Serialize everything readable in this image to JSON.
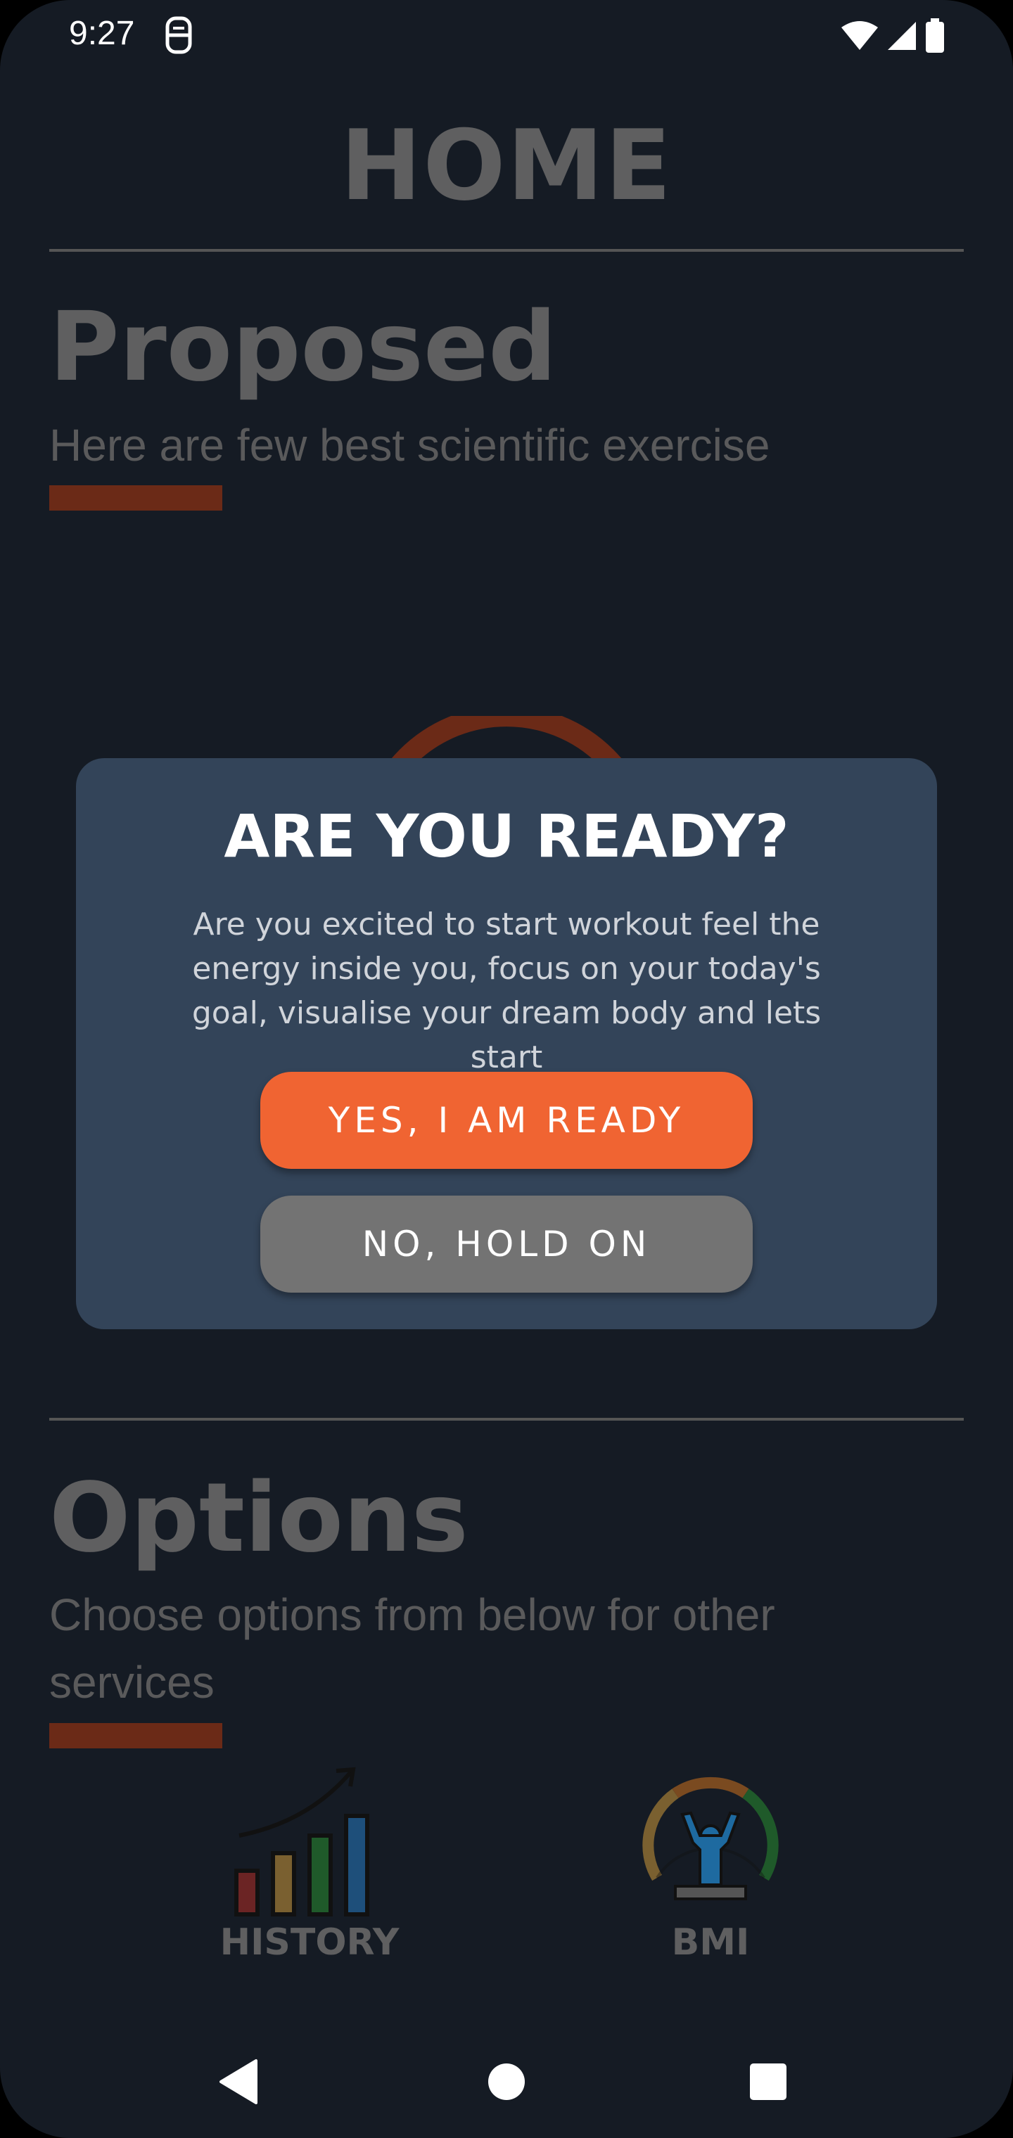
{
  "status_bar": {
    "time": "9:27",
    "sim_icon": "sim-card-icon",
    "icons": [
      "wifi-icon",
      "signal-icon",
      "battery-icon"
    ]
  },
  "header": {
    "title": "HOME"
  },
  "proposed": {
    "heading": "Proposed",
    "subtitle": "Here are few best scientific exercise"
  },
  "dialog": {
    "title": "ARE YOU READY?",
    "body": "Are you excited to start workout feel the energy inside you, focus on your today's goal, visualise your dream body and lets start",
    "confirm_label": "YES, I AM READY",
    "cancel_label": "NO, HOLD ON"
  },
  "options": {
    "heading": "Options",
    "subtitle": "Choose options from below for other services",
    "items": [
      {
        "label": "HISTORY",
        "icon": "history-chart-icon"
      },
      {
        "label": "BMI",
        "icon": "bmi-gauge-icon"
      }
    ]
  },
  "nav": {
    "back": "back-icon",
    "home": "home-icon",
    "recents": "recents-icon"
  },
  "colors": {
    "background": "#151b24",
    "dialog": "#334459",
    "accent": "#f06432",
    "secondary_button": "#737373",
    "accent_bar": "#6b2a17"
  }
}
